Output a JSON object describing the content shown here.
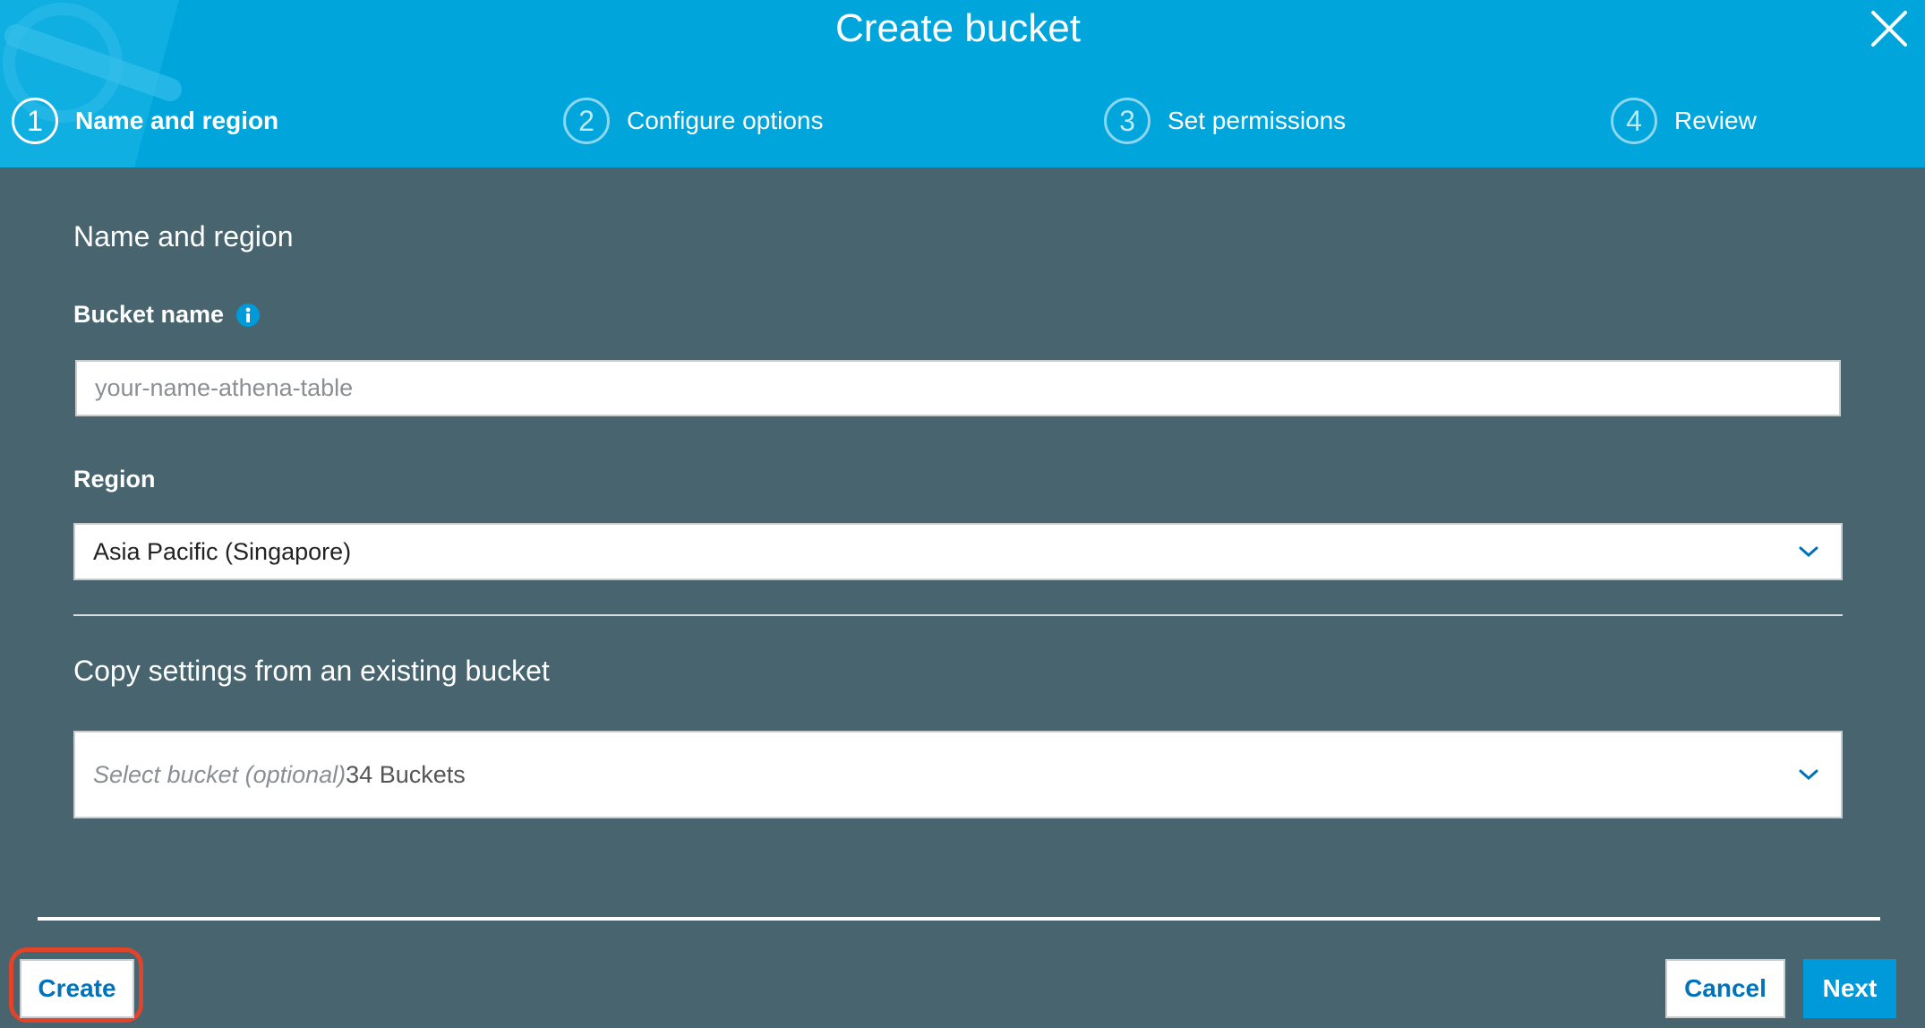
{
  "header": {
    "title": "Create bucket",
    "steps": [
      {
        "number": "1",
        "label": "Name and region"
      },
      {
        "number": "2",
        "label": "Configure options"
      },
      {
        "number": "3",
        "label": "Set permissions"
      },
      {
        "number": "4",
        "label": "Review"
      }
    ]
  },
  "form": {
    "section_title": "Name and region",
    "bucket_name_label": "Bucket name",
    "bucket_name_placeholder": "your-name-athena-table",
    "bucket_name_value": "",
    "region_label": "Region",
    "region_value": "Asia Pacific (Singapore)",
    "copy_settings_title": "Copy settings from an existing bucket",
    "copy_select_placeholder": "Select bucket (optional)",
    "copy_select_count": "34 Buckets"
  },
  "footer": {
    "create_label": "Create",
    "cancel_label": "Cancel",
    "next_label": "Next"
  },
  "colors": {
    "header_bg": "#00a6db",
    "body_bg": "#47646f",
    "primary_button": "#0099d9",
    "link_blue": "#0073bb",
    "highlight_ring": "#e0442a"
  },
  "icons": [
    "close-icon",
    "info-icon",
    "chevron-down-icon"
  ]
}
